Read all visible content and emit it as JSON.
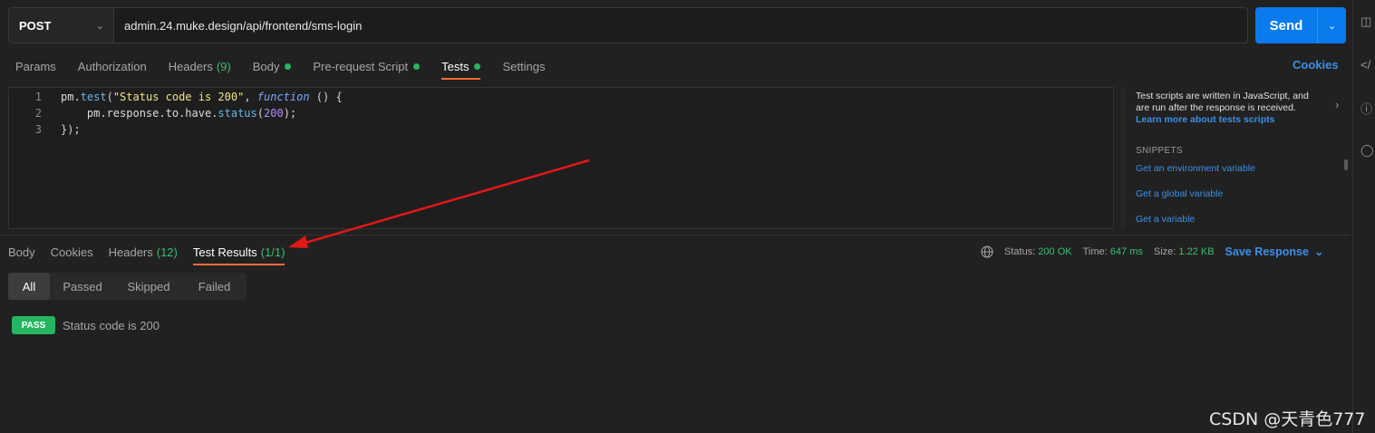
{
  "request": {
    "method": "POST",
    "url": "admin.24.muke.design/api/frontend/sms-login",
    "send_label": "Send"
  },
  "request_tabs": [
    {
      "label": "Params"
    },
    {
      "label": "Authorization"
    },
    {
      "label": "Headers",
      "count": "(9)"
    },
    {
      "label": "Body",
      "dot": true
    },
    {
      "label": "Pre-request Script",
      "dot": true
    },
    {
      "label": "Tests",
      "dot": true,
      "active": true
    },
    {
      "label": "Settings"
    }
  ],
  "cookies_label": "Cookies",
  "editor": {
    "line_numbers": [
      "1",
      "2",
      "3"
    ],
    "line1": {
      "obj": "pm.",
      "fn": "test",
      "p1": "(",
      "str": "\"Status code is 200\"",
      "p2": ", ",
      "kw": "function",
      "p3": " () {"
    },
    "line2": {
      "indent": "    ",
      "obj": "pm.response.to.have.",
      "fn": "status",
      "p1": "(",
      "num": "200",
      "p2": ");"
    },
    "line3": {
      "text": "});"
    }
  },
  "snippets": {
    "info": "Test scripts are written in JavaScript, and are run after the response is received.",
    "learn_more": "Learn more about tests scripts",
    "heading": "SNIPPETS",
    "items": [
      "Get an environment variable",
      "Get a global variable",
      "Get a variable"
    ]
  },
  "response_tabs": [
    {
      "label": "Body"
    },
    {
      "label": "Cookies"
    },
    {
      "label": "Headers",
      "count": "(12)"
    },
    {
      "label": "Test Results",
      "count": "(1/1)",
      "active": true
    }
  ],
  "response_meta": {
    "status_label": "Status:",
    "status_value": "200 OK",
    "time_label": "Time:",
    "time_value": "647 ms",
    "size_label": "Size:",
    "size_value": "1.22 KB",
    "save_label": "Save Response"
  },
  "filters": [
    "All",
    "Passed",
    "Skipped",
    "Failed"
  ],
  "result": {
    "badge": "PASS",
    "name": "Status code is 200"
  },
  "watermark": "CSDN @天青色777",
  "colors": {
    "accent": "#ff6c37",
    "send": "#097bed",
    "pass": "#26b661",
    "link": "#3d8fe6",
    "arrow": "#e01818"
  }
}
